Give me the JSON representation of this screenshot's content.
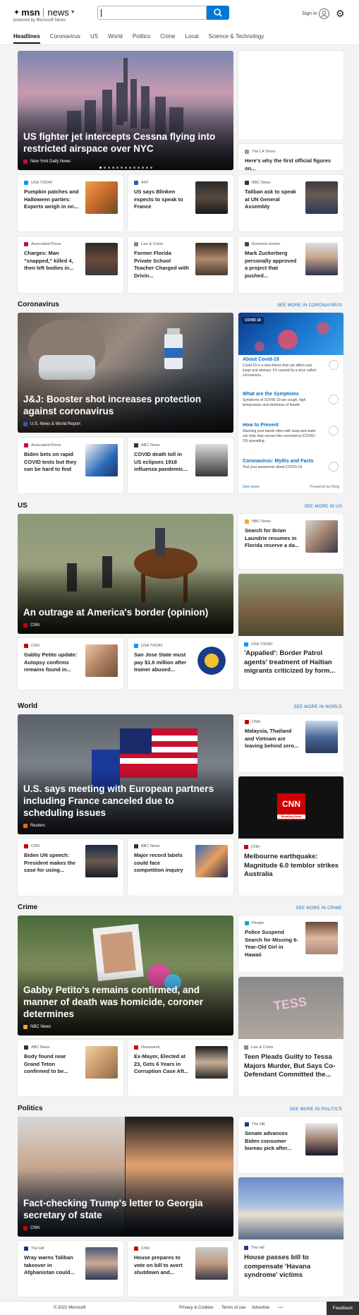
{
  "header": {
    "brand": "msn",
    "product": "news",
    "powered": "powered by Microsoft News",
    "signin": "Sign in"
  },
  "nav": [
    "Headlines",
    "Coronavirus",
    "US",
    "World",
    "Politics",
    "Crime",
    "Local",
    "Science & Technology"
  ],
  "headlines": {
    "hero": {
      "title": "US fighter jet intercepts Cessna flying into restricted airspace over NYC",
      "source": "New York Daily News"
    },
    "side": {
      "source": "The LA Times",
      "title": "Here's why the first official figures on..."
    },
    "cards": [
      {
        "source": "USA TODAY",
        "title": "Pumpkin patches and Halloween parties: Experts weigh in on..."
      },
      {
        "source": "AFP",
        "title": "US says Blinken expects to speak to France"
      },
      {
        "source": "BBC News",
        "title": "Taliban ask to speak at UN General Assembly"
      },
      {
        "source": "Associated Press",
        "title": "Charges: Man \"snapped,\" killed 4, then left bodies in..."
      },
      {
        "source": "Law & Crime",
        "title": "Former Florida Private School Teacher Charged with Drivin..."
      },
      {
        "source": "Business Insider",
        "title": "Mark Zuckerberg personally approved a project that pushed..."
      }
    ]
  },
  "coronavirus": {
    "label": "Coronavirus",
    "more": "SEE MORE IN CORONAVIRUS",
    "hero": {
      "title": "J&J: Booster shot increases protection against coronavirus",
      "source": "U.S. News & World Report"
    },
    "cards": [
      {
        "source": "Associated Press",
        "title": "Biden bets on rapid COVID tests but they can be hard to find"
      },
      {
        "source": "ABC News",
        "title": "COVID death toll in US eclipses 1918 influenza pandemic..."
      }
    ],
    "widget": {
      "tag": "COVID 19",
      "items": [
        {
          "h": "About Covid-19",
          "d": "Covid-19 is a new illness that can affect your lungs and airways. It's caused by a virus called coronavirus."
        },
        {
          "h": "What are the Symptoms",
          "d": "Symptoms of COVID-19 are cough, high temperature and shortness of breath."
        },
        {
          "h": "How to Prevent",
          "d": "Washing your hands often with soap and water can help stop viruses like coronavirus (COVID-19) spreading."
        },
        {
          "h": "Coronavirus: Myths and Facts",
          "d": "Test your awareness about COVID-19."
        }
      ],
      "seemore": "See more",
      "powered": "Powered by Bing"
    }
  },
  "us": {
    "label": "US",
    "more": "SEE MORE IN US",
    "hero": {
      "title": "An outrage at America's border (opinion)",
      "source": "CNN"
    },
    "side": {
      "source": "NBC News",
      "title": "Search for Brian Laundrie resumes in Florida reserve a da..."
    },
    "big": {
      "source": "USA TODAY",
      "title": "'Appalled': Border Patrol agents' treatment of Haitian migrants criticized by form..."
    },
    "cards": [
      {
        "source": "CNN",
        "title": "Gabby Petito update: Autopsy confirms remains found in..."
      },
      {
        "source": "USA TODAY",
        "title": "San Jose State must pay $1.6 million after trainer abused..."
      }
    ]
  },
  "world": {
    "label": "World",
    "more": "SEE MORE IN WORLD",
    "hero": {
      "title": "U.S. says meeting with European partners including France canceled due to scheduling issues",
      "source": "Reuters"
    },
    "side": {
      "source": "CNN",
      "title": "Malaysia, Thailand and Vietnam are leaving behind zero..."
    },
    "big": {
      "source": "CNN",
      "title": "Melbourne earthquake: Magnitude 6.0 temblor strikes Australia",
      "logo": "CNN",
      "logosub": "Breaking News"
    },
    "cards": [
      {
        "source": "CNN",
        "title": "Biden UN speech: President makes the case for using..."
      },
      {
        "source": "BBC News",
        "title": "Major record labels could face competition inquiry"
      }
    ]
  },
  "crime": {
    "label": "Crime",
    "more": "SEE MORE IN CRIME",
    "hero": {
      "title": "Gabby Petito's remains confirmed, and manner of death was homicide, coroner determines",
      "source": "NBC News"
    },
    "side": {
      "source": "People",
      "title": "Police Suspend Search for Missing 6-Year-Old Girl in Hawaii"
    },
    "big": {
      "source": "Law & Crime",
      "title": "Teen Pleads Guilty to Tessa Majors Murder, But Says Co-Defendant Committed the...",
      "chalk": "TESS"
    },
    "cards": [
      {
        "source": "ABC News",
        "title": "Body found near Grand Teton confirmed to be..."
      },
      {
        "source": "Newsweek",
        "title": "Ex-Mayor, Elected at 23, Gets 6 Years in Corruption Case Aft..."
      }
    ]
  },
  "politics": {
    "label": "Politics",
    "more": "SEE MORE IN POLITICS",
    "hero": {
      "title": "Fact-checking Trump's letter to Georgia secretary of state",
      "source": "CNN"
    },
    "side": {
      "source": "The Hill",
      "title": "Senate advances Biden consumer bureau pick after..."
    },
    "big": {
      "source": "The Hill",
      "title": "House passes bill to compensate 'Havana syndrome' victims"
    },
    "cards": [
      {
        "source": "The Hill",
        "title": "Wray warns Taliban takeover in Afghanistan could..."
      },
      {
        "source": "CNN",
        "title": "House prepares to vote on bill to avert shutdown and..."
      }
    ]
  },
  "footer": {
    "copyright": "© 2021 Microsoft",
    "links": [
      "Privacy & Cookies",
      "Terms of use",
      "Advertise"
    ],
    "feedback": "Feedback"
  }
}
